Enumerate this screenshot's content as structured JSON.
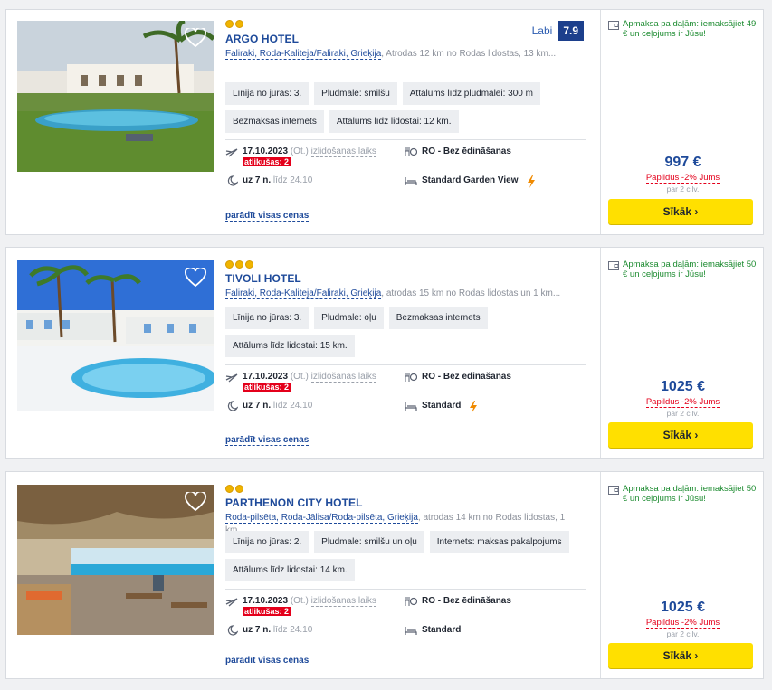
{
  "hotels": [
    {
      "stars": 2,
      "name": "ARGO HOTEL",
      "location_link": "Faliraki, Roda-Kaliteja/Faliraki, Grieķija",
      "location_rest": ", Atrodas 12 km no Rodas lidostas, 13 km...",
      "rating_label": "Labi",
      "rating_value": "7.9",
      "features": [
        "Līnija no jūras: 3.",
        "Pludmale: smilšu",
        "Attālums līdz pludmalei: 300 m",
        "Bezmaksas internets",
        "Attālums līdz lidostai: 12 km."
      ],
      "date": "17.10.2023",
      "weekday": "(Ot.)",
      "departure_time": "izlidošanas laiks",
      "seats_left": "atlikušas: 2",
      "nights": "uz 7 n.",
      "until": "līdz 24.10",
      "meal": "RO - Bez ēdināšanas",
      "room": "Standard Garden View",
      "room_bolt": true,
      "all_prices": "parādīt visas cenas",
      "promo": "Apmaksa pa daļām: iemaksājiet 49 € un ceļojums ir Jūsu!",
      "price": "997 €",
      "extra": "Papildus -2% Jums",
      "per": "par 2 cilv.",
      "button": "Sīkāk ›"
    },
    {
      "stars": 3,
      "name": "TIVOLI HOTEL",
      "location_link": "Faliraki, Roda-Kaliteja/Faliraki, Grieķija",
      "location_rest": ", atrodas 15 km no Rodas lidostas un 1 km...",
      "rating_label": "",
      "rating_value": "",
      "features": [
        "Līnija no jūras: 3.",
        "Pludmale: oļu",
        "Bezmaksas internets",
        "Attālums līdz lidostai: 15 km."
      ],
      "date": "17.10.2023",
      "weekday": "(Ot.)",
      "departure_time": "izlidošanas laiks",
      "seats_left": "atlikušas: 2",
      "nights": "uz 7 n.",
      "until": "līdz 24.10",
      "meal": "RO - Bez ēdināšanas",
      "room": "Standard",
      "room_bolt": true,
      "all_prices": "parādīt visas cenas",
      "promo": "Apmaksa pa daļām: iemaksājiet 50 € un ceļojums ir Jūsu!",
      "price": "1025 €",
      "extra": "Papildus -2% Jums",
      "per": "par 2 cilv.",
      "button": "Sīkāk ›"
    },
    {
      "stars": 2,
      "name": "PARTHENON CITY HOTEL",
      "location_link": "Roda-pilsēta, Roda-Jālisa/Roda-pilsēta, Grieķija",
      "location_rest": ", atrodas 14 km no Rodas lidostas, 1 km...",
      "rating_label": "",
      "rating_value": "",
      "features": [
        "Līnija no jūras: 2.",
        "Pludmale: smilšu un oļu",
        "Internets: maksas pakalpojums",
        "Attālums līdz lidostai: 14 km."
      ],
      "date": "17.10.2023",
      "weekday": "(Ot.)",
      "departure_time": "izlidošanas laiks",
      "seats_left": "atlikušas: 2",
      "nights": "uz 7 n.",
      "until": "līdz 24.10",
      "meal": "RO - Bez ēdināšanas",
      "room": "Standard",
      "room_bolt": false,
      "all_prices": "parādīt visas cenas",
      "promo": "Apmaksa pa daļām: iemaksājiet 50 € un ceļojums ir Jūsu!",
      "price": "1025 €",
      "extra": "Papildus -2% Jums",
      "per": "par 2 cilv.",
      "button": "Sīkāk ›"
    }
  ],
  "colors": {
    "accent": "#1e4a9a",
    "button": "#ffe000",
    "promo": "#1a8a2e",
    "discount": "#e4001b"
  },
  "icons": [
    "heart-icon",
    "plane-icon",
    "moon-icon",
    "meal-icon",
    "bed-icon",
    "bolt-icon",
    "wallet-icon"
  ]
}
